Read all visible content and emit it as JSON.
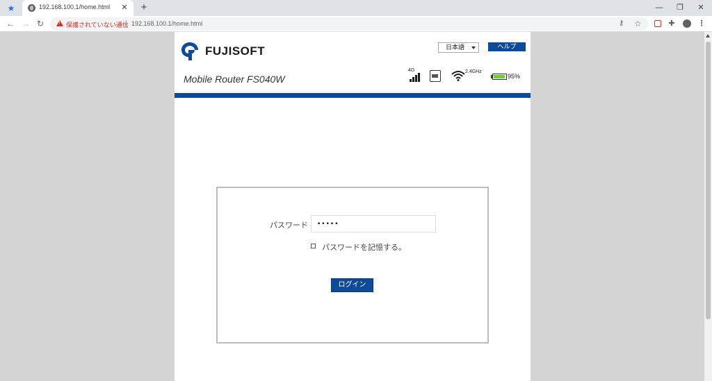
{
  "browser": {
    "tab_title": "192.168.100.1/home.html",
    "new_tab_label": "+",
    "security_warning": "保護されていない通信",
    "url": "192.168.100.1/home.html"
  },
  "header": {
    "logo_text": "FUJISOFT",
    "language": "日本語",
    "help_label": "ヘルプ",
    "model_name": "Mobile Router FS040W"
  },
  "status": {
    "network_type": "4G",
    "signal_bars": 4,
    "wifi_band": "2.4GHz",
    "battery_level": 0.95,
    "battery_text": "95%"
  },
  "login": {
    "password_label": "パスワード",
    "password_value": "•••••",
    "remember_label": "パスワードを記憶する。",
    "remember_checked": false,
    "login_button": "ログイン"
  },
  "colors": {
    "brand_blue": "#0d4a9a",
    "warning_red": "#d93025",
    "battery_green": "#6fcf2f"
  }
}
